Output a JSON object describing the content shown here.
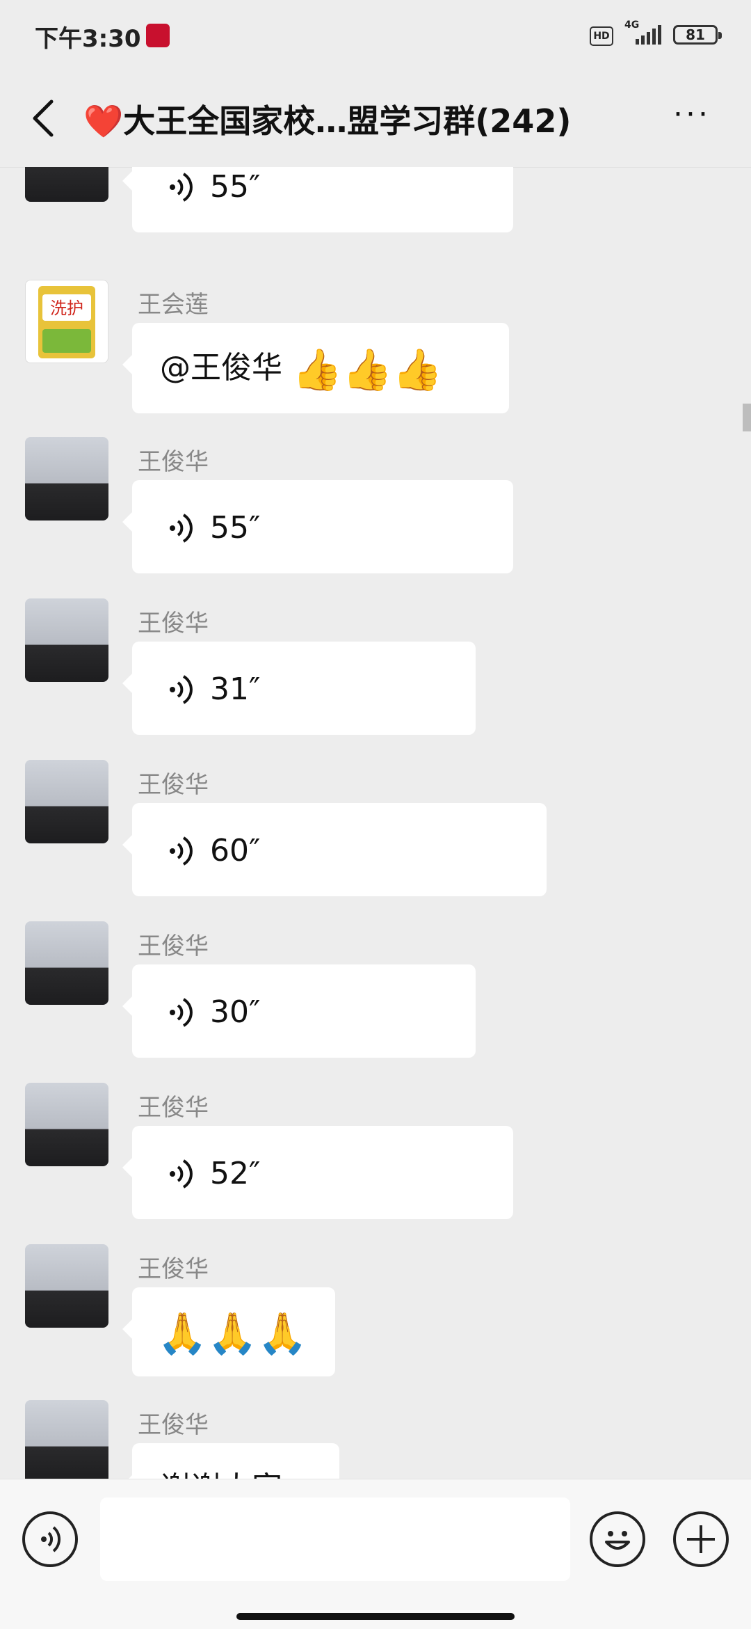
{
  "status_bar": {
    "time": "下午3:30",
    "hd": "HD",
    "network": "4G",
    "battery": "81"
  },
  "header": {
    "title": "❤️大王全国家校…盟学习群(242)",
    "more": "···"
  },
  "messages": [
    {
      "sender": "",
      "type": "voice",
      "duration": "55″"
    },
    {
      "sender": "王会莲",
      "type": "text",
      "text": "@王俊华",
      "emoji": "👍👍👍"
    },
    {
      "sender": "王俊华",
      "type": "voice",
      "duration": "55″"
    },
    {
      "sender": "王俊华",
      "type": "voice",
      "duration": "31″"
    },
    {
      "sender": "王俊华",
      "type": "voice",
      "duration": "60″"
    },
    {
      "sender": "王俊华",
      "type": "voice",
      "duration": "30″"
    },
    {
      "sender": "王俊华",
      "type": "voice",
      "duration": "52″"
    },
    {
      "sender": "王俊华",
      "type": "emoji",
      "emoji": "🙏🙏🙏"
    },
    {
      "sender": "王俊华",
      "type": "text",
      "text": "谢谢大家"
    }
  ],
  "input_bar": {
    "icons": [
      "voice-icon",
      "emoji-icon",
      "plus-icon"
    ]
  }
}
